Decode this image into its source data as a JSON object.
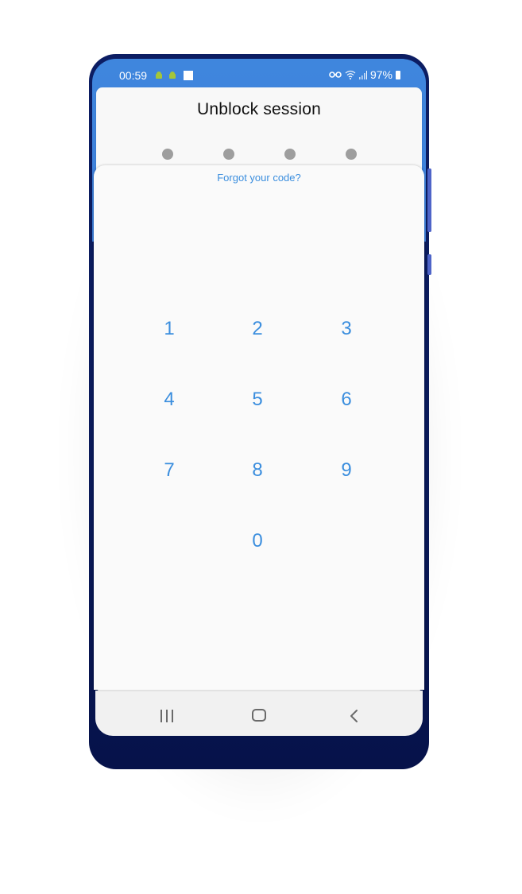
{
  "status_bar": {
    "time": "00:59",
    "battery": "97%"
  },
  "screen": {
    "title": "Unblock session",
    "pin_length": 4,
    "forgot_link": "Forgot your code?"
  },
  "keypad": {
    "keys": [
      "1",
      "2",
      "3",
      "4",
      "5",
      "6",
      "7",
      "8",
      "9",
      "0"
    ]
  },
  "nav_bar": {
    "recent": "recent-apps-icon",
    "home": "home-icon",
    "back": "back-icon"
  },
  "colors": {
    "accent": "#3b8ede",
    "status_bar": "#3f86dd",
    "phone_frame": "#0a1a59",
    "pin_dot": "#9e9e9e"
  }
}
